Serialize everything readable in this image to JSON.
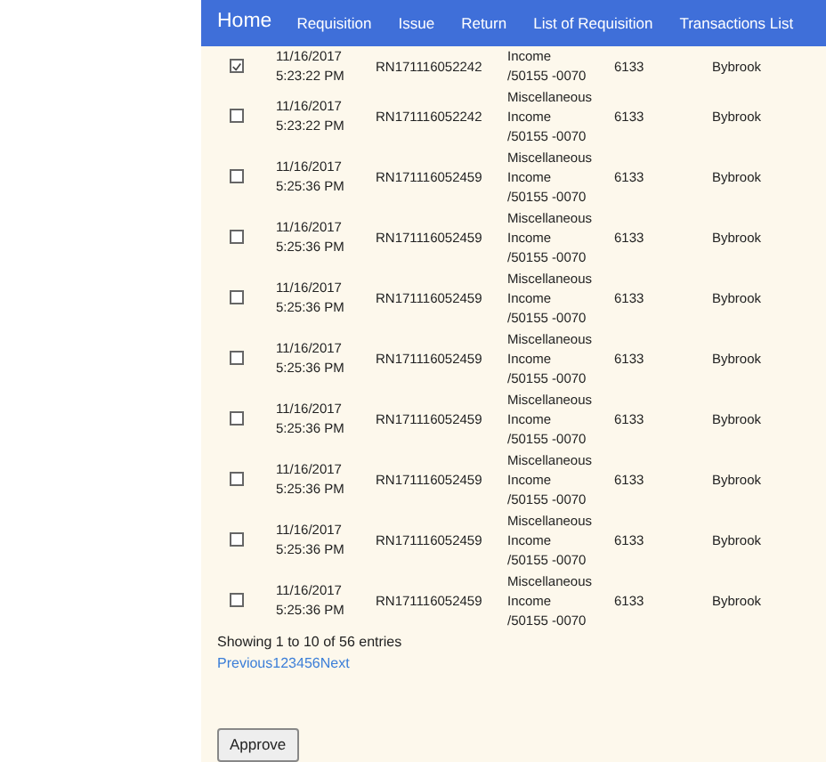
{
  "navbar": {
    "brand": "Home",
    "links": [
      {
        "label": "Requisition"
      },
      {
        "label": "Issue"
      },
      {
        "label": "Return"
      },
      {
        "label": "List of Requisition"
      },
      {
        "label": "Transactions List"
      }
    ]
  },
  "table": {
    "rows": [
      {
        "checked": true,
        "date": "11/16/2017\n5:23:22 PM",
        "reference": "RN171116052242",
        "description": "Income\n/50155 -0070",
        "code": "6133",
        "location": "Bybrook"
      },
      {
        "checked": false,
        "date": "11/16/2017\n5:23:22 PM",
        "reference": "RN171116052242",
        "description": "Miscellaneous\nIncome\n/50155 -0070",
        "code": "6133",
        "location": "Bybrook"
      },
      {
        "checked": false,
        "date": "11/16/2017\n5:25:36 PM",
        "reference": "RN171116052459",
        "description": "Miscellaneous\nIncome\n/50155 -0070",
        "code": "6133",
        "location": "Bybrook"
      },
      {
        "checked": false,
        "date": "11/16/2017\n5:25:36 PM",
        "reference": "RN171116052459",
        "description": "Miscellaneous\nIncome\n/50155 -0070",
        "code": "6133",
        "location": "Bybrook"
      },
      {
        "checked": false,
        "date": "11/16/2017\n5:25:36 PM",
        "reference": "RN171116052459",
        "description": "Miscellaneous\nIncome\n/50155 -0070",
        "code": "6133",
        "location": "Bybrook"
      },
      {
        "checked": false,
        "date": "11/16/2017\n5:25:36 PM",
        "reference": "RN171116052459",
        "description": "Miscellaneous\nIncome\n/50155 -0070",
        "code": "6133",
        "location": "Bybrook"
      },
      {
        "checked": false,
        "date": "11/16/2017\n5:25:36 PM",
        "reference": "RN171116052459",
        "description": "Miscellaneous\nIncome\n/50155 -0070",
        "code": "6133",
        "location": "Bybrook"
      },
      {
        "checked": false,
        "date": "11/16/2017\n5:25:36 PM",
        "reference": "RN171116052459",
        "description": "Miscellaneous\nIncome\n/50155 -0070",
        "code": "6133",
        "location": "Bybrook"
      },
      {
        "checked": false,
        "date": "11/16/2017\n5:25:36 PM",
        "reference": "RN171116052459",
        "description": "Miscellaneous\nIncome\n/50155 -0070",
        "code": "6133",
        "location": "Bybrook"
      },
      {
        "checked": false,
        "date": "11/16/2017\n5:25:36 PM",
        "reference": "RN171116052459",
        "description": "Miscellaneous\nIncome\n/50155 -0070",
        "code": "6133",
        "location": "Bybrook"
      }
    ]
  },
  "info": "Showing 1 to 10 of 56 entries",
  "pagination": [
    {
      "label": "Previous"
    },
    {
      "label": "1"
    },
    {
      "label": "2"
    },
    {
      "label": "3"
    },
    {
      "label": "4"
    },
    {
      "label": "5"
    },
    {
      "label": "6"
    },
    {
      "label": "Next"
    }
  ],
  "approve_button": "Approve"
}
